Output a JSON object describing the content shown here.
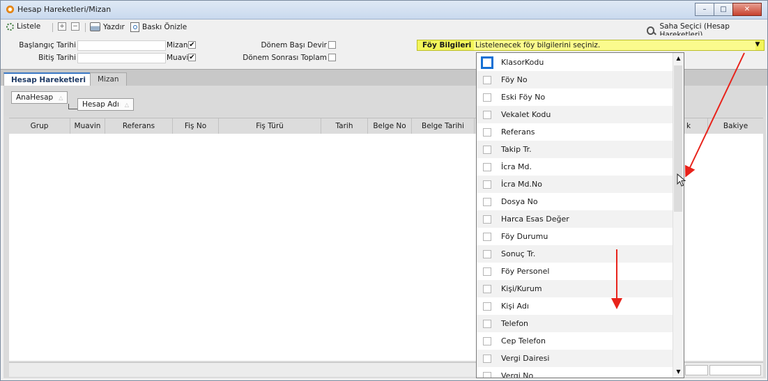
{
  "window": {
    "title": "Hesap Hareketleri/Mizan",
    "controls": {
      "minimize": "–",
      "maximize": "□",
      "close": "✕"
    }
  },
  "toolbar": {
    "list_label": "Listele",
    "expand_symbol": "+",
    "collapse_symbol": "−",
    "print_label": "Yazdır",
    "preview_label": "Baskı Önizle",
    "field_selector_label": "Saha Seçici (Hesap Hareketleri)"
  },
  "filters": {
    "start_date_label": "Başlangıç Tarihi",
    "start_date_value": "",
    "end_date_label": "Bitiş Tarihi",
    "end_date_value": "",
    "mizan_label": "Mizan",
    "mizan_checked": "✔",
    "muavin_label": "Muavin",
    "muavin_checked": "✔",
    "opening_label": "Dönem Başı Devir",
    "closing_label": "Dönem Sonrası Toplam",
    "foy_label": "Föy Bilgileri",
    "foy_placeholder": "Listelenecek föy bilgilerini seçiniz.",
    "foy_arrow": "▼"
  },
  "tabs": [
    {
      "label": "Hesap Hareketleri",
      "active": true
    },
    {
      "label": "Mizan",
      "active": false
    }
  ],
  "grouping": {
    "items": [
      {
        "label": "AnaHesap",
        "sort": "△"
      },
      {
        "label": "Hesap Adı",
        "sort": "△"
      }
    ]
  },
  "grid": {
    "columns": [
      "Grup",
      "Muavin",
      "Referans",
      "Fiş No",
      "Fiş Türü",
      "Tarih",
      "Belge No",
      "Belge Tarihi",
      "k",
      "Bakiye"
    ]
  },
  "dropdown": {
    "items": [
      "KlasorKodu",
      "Föy No",
      "Eski Föy No",
      "Vekalet Kodu",
      "Referans",
      "Takip Tr.",
      "İcra Md.",
      "İcra Md.No",
      "Dosya No",
      "Harca Esas Değer",
      "Föy Durumu",
      "Sonuç Tr.",
      "Föy Personel",
      "Kişi/Kurum",
      "Kişi Adı",
      "Telefon",
      "Cep Telefon",
      "Vergi Dairesi",
      "Vergi No"
    ],
    "scroll_up": "▲",
    "scroll_down": "▼"
  },
  "colors": {
    "highlight_yellow": "#f3f55a",
    "annotation_red": "#e8231b",
    "tab_accent": "#3a78c5",
    "focus_blue": "#1570d4"
  }
}
